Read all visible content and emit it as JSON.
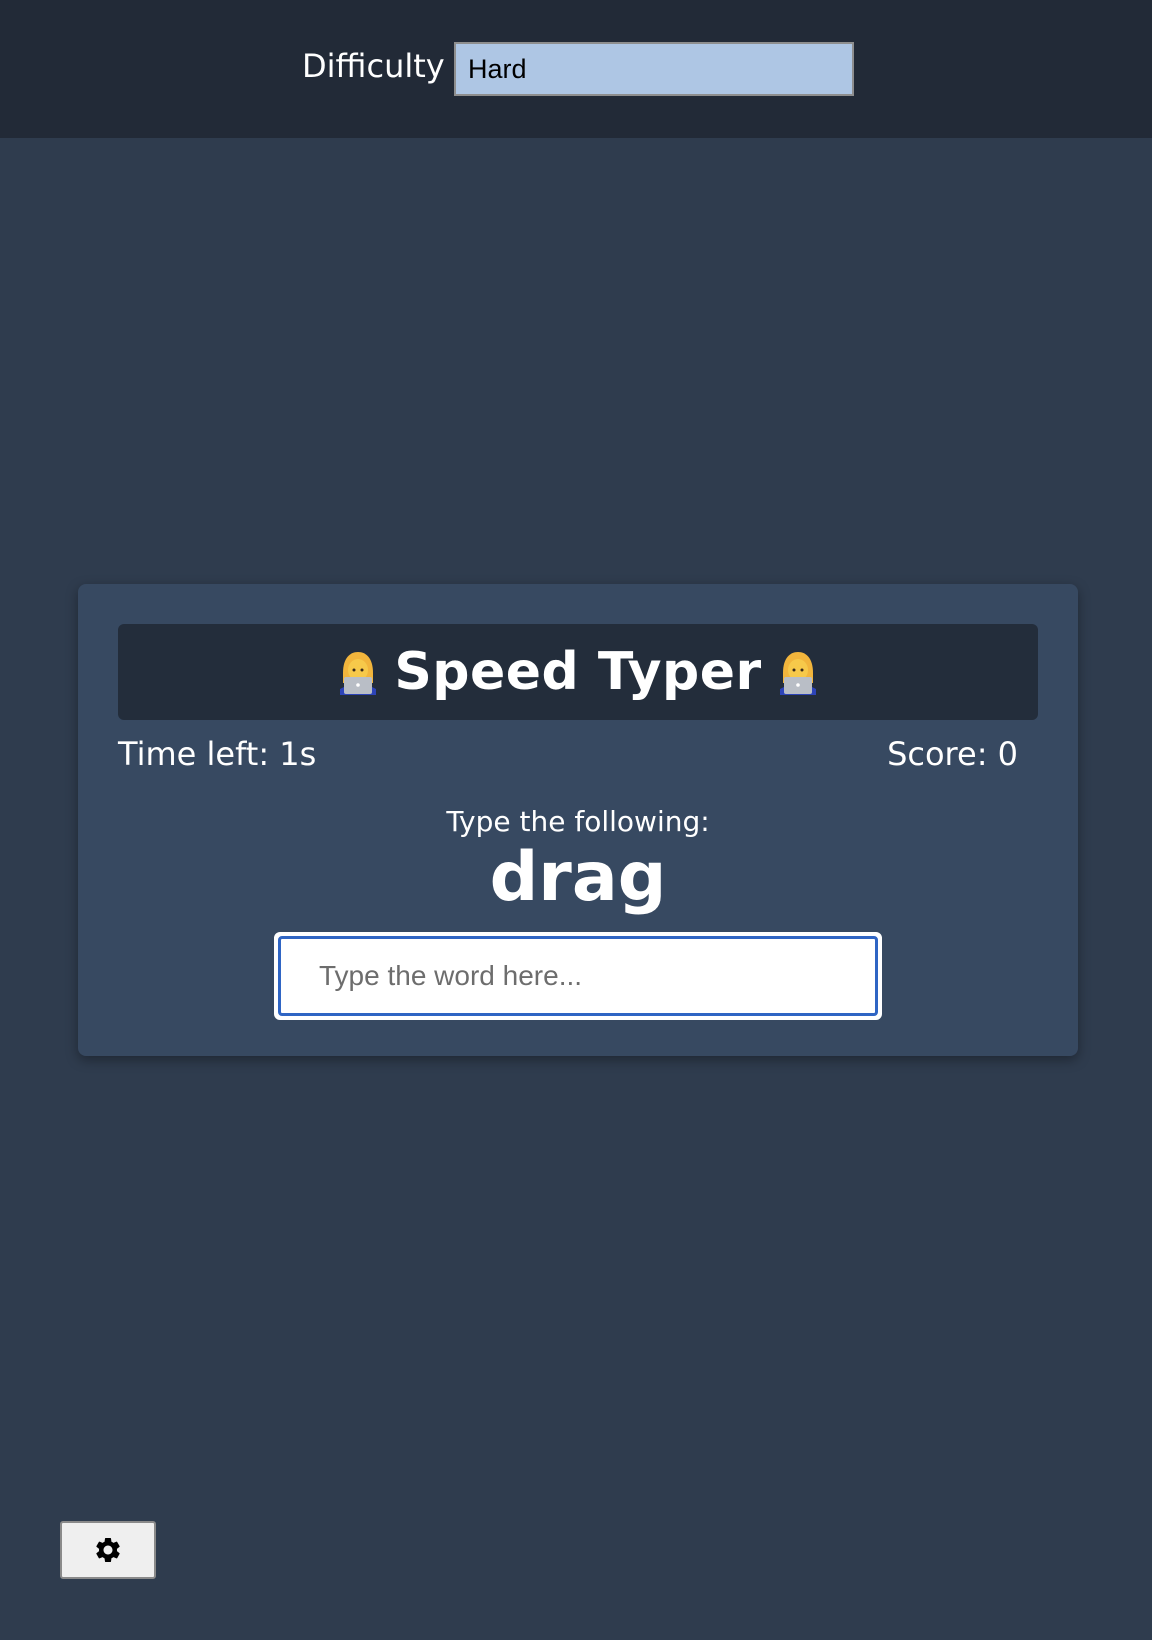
{
  "settings": {
    "difficulty_label": "Difficulty",
    "difficulty_value": "Hard",
    "settings_button_icon": "gear-icon"
  },
  "game": {
    "title": "Speed Typer",
    "title_icon": "woman-technologist-emoji",
    "time_left": "Time left: 1s",
    "score": "Score: 0",
    "prompt": "Type the following:",
    "word": "drag",
    "input_value": "",
    "input_placeholder": "Type the word here..."
  },
  "colors": {
    "page_bg": "#2f3c4e",
    "settings_bar_bg": "#222a37",
    "card_bg": "#374961",
    "title_banner_bg": "#232d3b",
    "select_bg": "#aec6e4",
    "input_focus_border": "#2f65c4"
  }
}
